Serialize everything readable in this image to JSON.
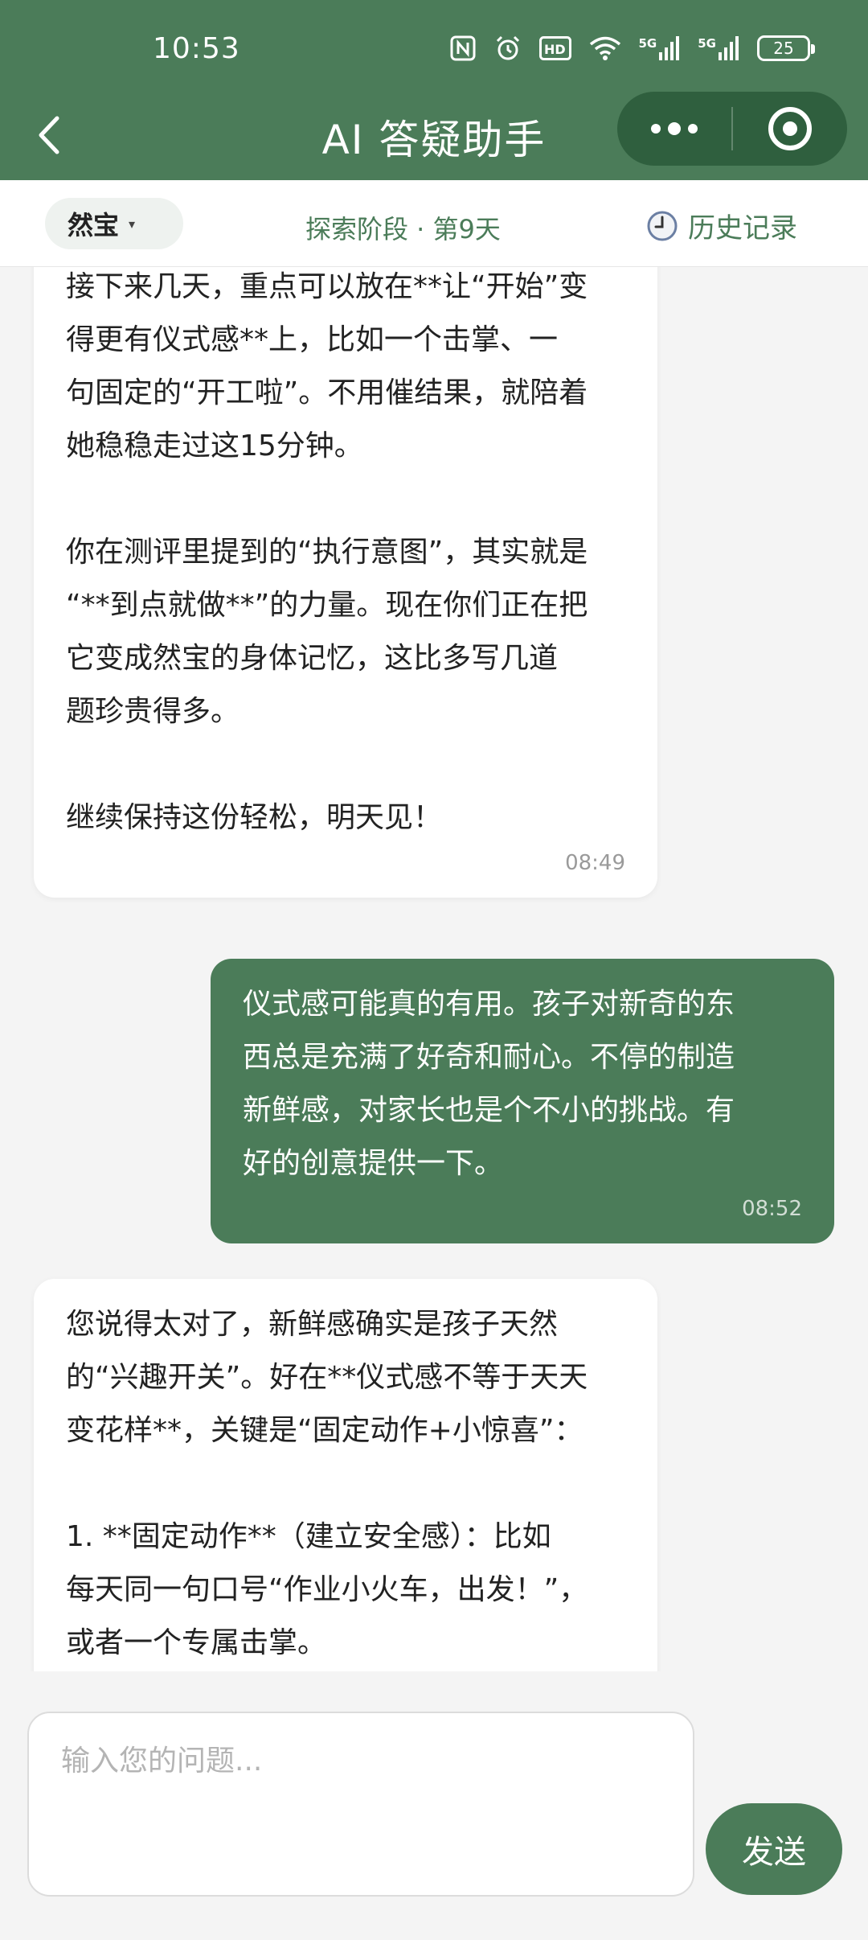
{
  "status_bar": {
    "time": "10:53",
    "network_1": "5G",
    "network_2": "5G",
    "battery": "25"
  },
  "header": {
    "title": "AI 答疑助手",
    "back_icon": "chevron-left-icon",
    "more_icon": "more-dots-icon",
    "close_icon": "target-circle-icon"
  },
  "subheader": {
    "child_name": "然宝",
    "child_caret": "▾",
    "stage": "探索阶段 · 第9天",
    "history_icon": "clock-icon",
    "history_label": "历史记录"
  },
  "messages": [
    {
      "role": "bot",
      "lines": [
        "接下来几天，重点可以放在**让“开始”变",
        "得更有仪式感**上，比如一个击掌、一",
        "句固定的“开工啦”。不用催结果，就陪着",
        "她稳稳走过这15分钟。",
        "",
        "你在测评里提到的“执行意图”，其实就是",
        "“**到点就做**”的力量。现在你们正在把",
        "它变成然宝的身体记忆，这比多写几道",
        "题珍贵得多。",
        "",
        "继续保持这份轻松，明天见！"
      ],
      "time": "08:49"
    },
    {
      "role": "user",
      "lines": [
        "仪式感可能真的有用。孩子对新奇的东",
        "西总是充满了好奇和耐心。不停的制造",
        "新鲜感，对家长也是个不小的挑战。有",
        "好的创意提供一下。"
      ],
      "time": "08:52"
    },
    {
      "role": "bot",
      "lines": [
        "您说得太对了，新鲜感确实是孩子天然",
        "的“兴趣开关”。好在**仪式感不等于天天",
        "变花样**，关键是“固定动作+小惊喜”：",
        "",
        "1. **固定动作**（建立安全感）：比如",
        "每天同一句口号“作业小火车，出发！”，",
        "或者一个专属击掌。"
      ],
      "time": ""
    }
  ],
  "composer": {
    "placeholder": "输入您的问题...",
    "send_label": "发送"
  },
  "colors": {
    "brand_green": "#4b7c59",
    "capsule_green": "#2f5f3e",
    "background": "#f4f4f4"
  }
}
